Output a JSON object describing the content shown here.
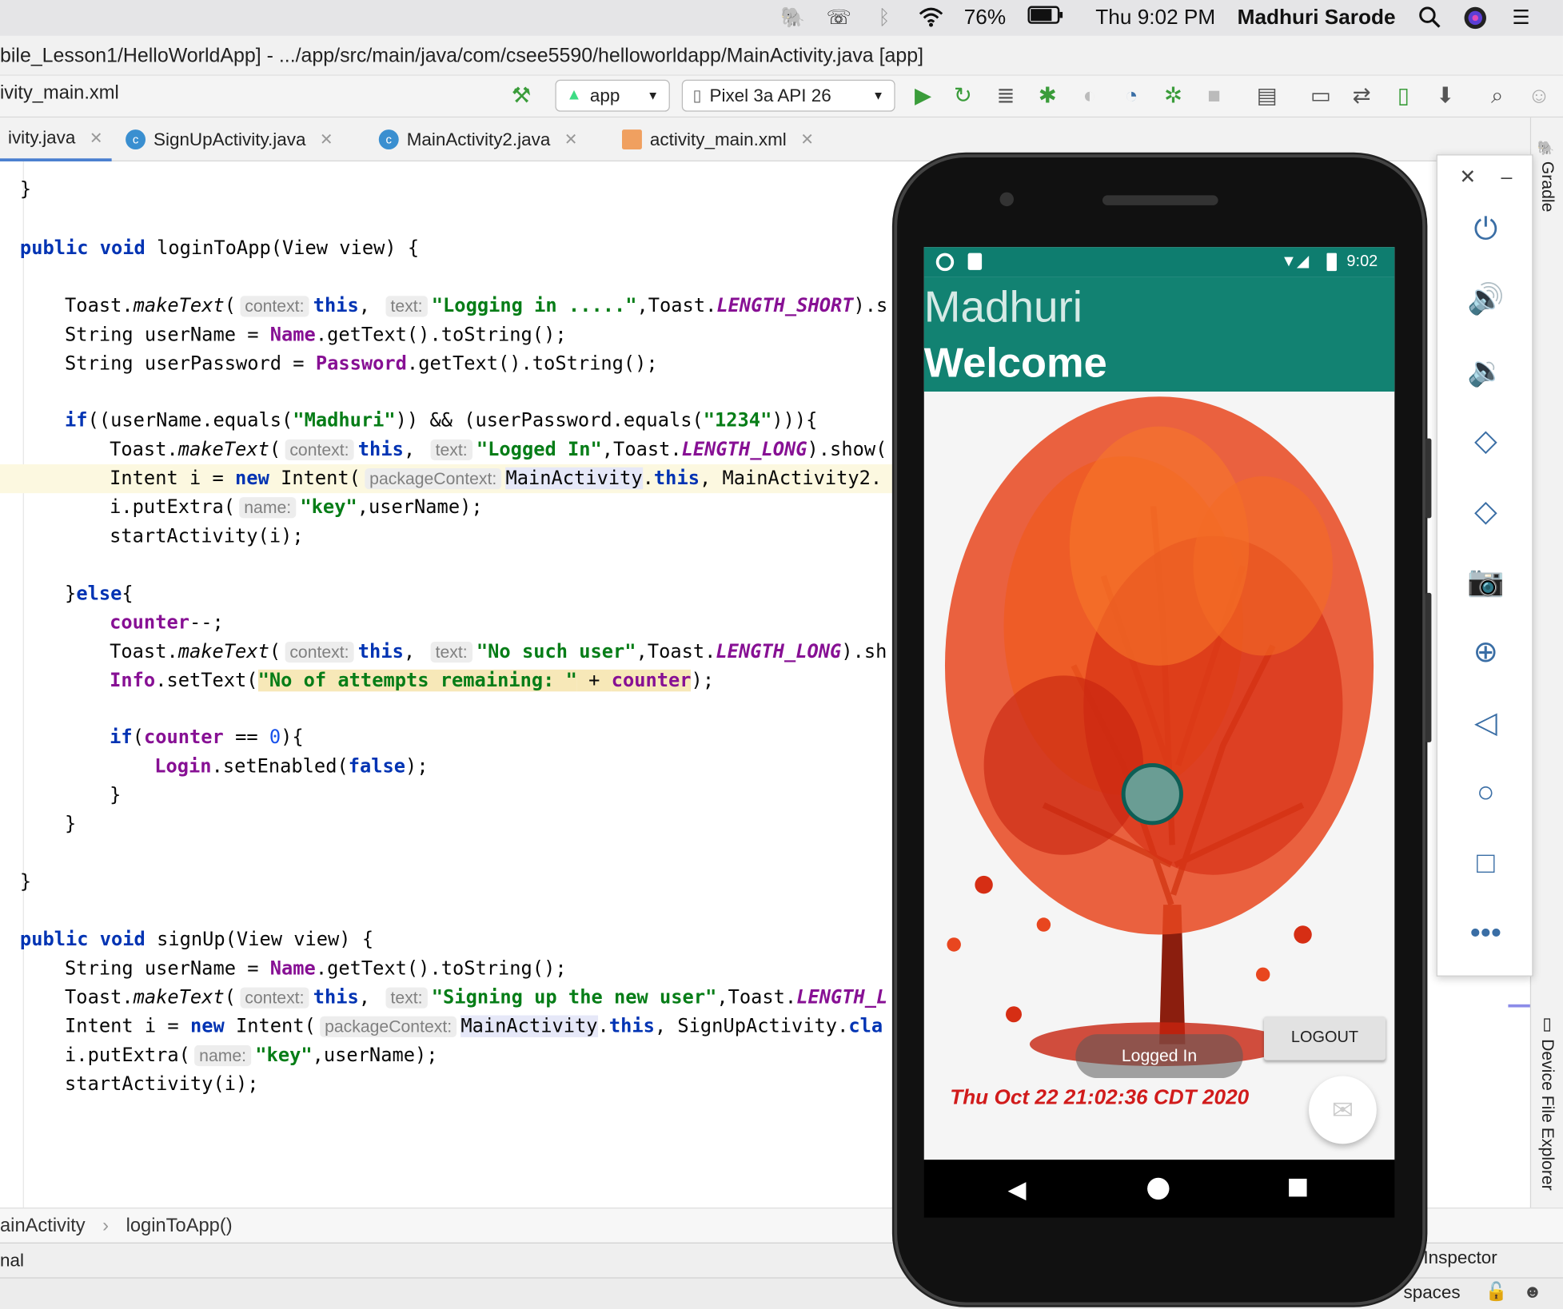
{
  "menubar": {
    "battery": "76%",
    "clock": "Thu 9:02 PM",
    "user": "Madhuri Sarode",
    "icons": [
      "evernote-icon",
      "viber-icon",
      "bluetooth-icon",
      "wifi-icon",
      "battery-icon",
      "search-icon",
      "siri-icon",
      "menu-list-icon"
    ]
  },
  "window": {
    "title": "bile_Lesson1/HelloWorldApp] - .../app/src/main/java/com/csee5590/helloworldapp/MainActivity.java [app]"
  },
  "toolbar": {
    "current_file": "ivity_main.xml",
    "run_config": "app",
    "device": "Pixel 3a API 26",
    "icons": [
      "build-hammer-icon",
      "run-icon",
      "apply-changes-icon",
      "coverage-icon",
      "debug-icon",
      "profile-icon",
      "profiler-icon",
      "attach-debugger-icon",
      "stop-icon",
      "project-structure-icon",
      "avd-icon",
      "sync-icon",
      "device-manager-icon",
      "sdk-icon",
      "search-icon",
      "account-icon"
    ]
  },
  "tabs": [
    {
      "label": "ivity.java",
      "active": true
    },
    {
      "label": "SignUpActivity.java",
      "active": false
    },
    {
      "label": "MainActivity2.java",
      "active": false
    },
    {
      "label": "activity_main.xml",
      "active": false
    }
  ],
  "code_segments": {
    "l0": "}",
    "l1_a": "public void ",
    "l1_b": "loginToApp(View view) {",
    "l2_a": "Toast.",
    "l2_b": "makeText",
    "l2_c": "(",
    "l2_hint": "context:",
    "l2_this": "this",
    "l2_d": ", ",
    "l2_hint2": "text:",
    "l2_str": "\"Logging in .....\"",
    "l2_e": ",Toast.",
    "l2_f": "LENGTH_SHORT",
    "l2_g": ").s",
    "l3_a": "String userName = ",
    "l3_b": "Name",
    "l3_c": ".getText().toString();",
    "l4_a": "String userPassword = ",
    "l4_b": "Password",
    "l4_c": ".getText().toString();",
    "l5_a": "if",
    "l5_b": "((userName.equals(",
    "l5_s1": "\"Madhuri\"",
    "l5_c": ")) && (userPassword.equals(",
    "l5_s2": "\"1234\"",
    "l5_d": "))){",
    "l6_a": "Toast.",
    "l6_b": "makeText",
    "l6_c": "(",
    "l6_hint": "context:",
    "l6_this": "this",
    "l6_d": ", ",
    "l6_hint2": "text:",
    "l6_str": "\"Logged In\"",
    "l6_e": ",Toast.",
    "l6_f": "LENGTH_LONG",
    "l6_g": ").show(",
    "l7_a": "Intent i = ",
    "l7_new": "new",
    "l7_b": " Intent(",
    "l7_hint": "packageContext:",
    "l7_c": "MainActivity",
    "l7_d": ".",
    "l7_this": "this",
    "l7_e": ", MainActivity2.",
    "l8_a": "i.putExtra(",
    "l8_hint": "name:",
    "l8_str": "\"key\"",
    "l8_b": ",userName);",
    "l9": "startActivity(i);",
    "l10_a": "}",
    "l10_b": "else",
    "l10_c": "{",
    "l11_a": "counter",
    "l11_b": "--;",
    "l12_a": "Toast.",
    "l12_b": "makeText",
    "l12_c": "(",
    "l12_hint": "context:",
    "l12_this": "this",
    "l12_d": ", ",
    "l12_hint2": "text:",
    "l12_str": "\"No such user\"",
    "l12_e": ",Toast.",
    "l12_f": "LENGTH_LONG",
    "l12_g": ").sh",
    "l13_a": "Info",
    "l13_b": ".setText(",
    "l13_str": "\"No of attempts remaining: \"",
    "l13_c": " + ",
    "l13_d": "counter",
    "l13_e": ");",
    "l14_a": "if",
    "l14_b": "(",
    "l14_c": "counter",
    "l14_d": " == ",
    "l14_num": "0",
    "l14_e": "){",
    "l15_a": "Login",
    "l15_b": ".setEnabled(",
    "l15_c": "false",
    "l15_d": ");",
    "l16": "}",
    "l17": "}",
    "l18": "}",
    "l19_a": "public void ",
    "l19_b": "signUp(View view) {",
    "l20_a": "String userName = ",
    "l20_b": "Name",
    "l20_c": ".getText().toString();",
    "l21_a": "Toast.",
    "l21_b": "makeText",
    "l21_c": "(",
    "l21_hint": "context:",
    "l21_this": "this",
    "l21_d": ", ",
    "l21_hint2": "text:",
    "l21_str": "\"Signing up the new user\"",
    "l21_e": ",Toast.",
    "l21_f": "LENGTH_L",
    "l22_a": "Intent i = ",
    "l22_new": "new",
    "l22_b": " Intent(",
    "l22_hint": "packageContext:",
    "l22_c": "MainActivity",
    "l22_d": ".",
    "l22_this": "this",
    "l22_e": ", SignUpActivity.",
    "l22_f": "cla",
    "l23_a": "i.putExtra(",
    "l23_hint": "name:",
    "l23_str": "\"key\"",
    "l23_b": ",userName);",
    "l24": "startActivity(i);"
  },
  "breadcrumb": {
    "class": "ainActivity",
    "sep": "›",
    "method": "loginToApp()"
  },
  "bottom": {
    "left": "nal",
    "right": "Inspector"
  },
  "statusbar": {
    "right": "spaces"
  },
  "right_strip": {
    "gradle": "Gradle",
    "device_file_explorer": "Device File Explorer"
  },
  "phone": {
    "status_time": "9:02",
    "app_title": "Madhuri",
    "welcome": "Welcome",
    "logout_button": "LOGOUT",
    "toast": "Logged In",
    "date": "Thu Oct 22 21:02:36 CDT 2020",
    "fab_icon": "email-icon",
    "colors": {
      "appbar": "#128272",
      "statusbar": "#0e7d6f",
      "date": "#d11b1b"
    }
  },
  "emulator_panel": {
    "icons": [
      "close-icon",
      "minimize-icon",
      "power-icon",
      "volume-up-icon",
      "volume-down-icon",
      "rotate-left-icon",
      "rotate-right-icon",
      "camera-icon",
      "zoom-icon",
      "back-icon",
      "home-icon",
      "overview-icon",
      "more-icon"
    ]
  }
}
